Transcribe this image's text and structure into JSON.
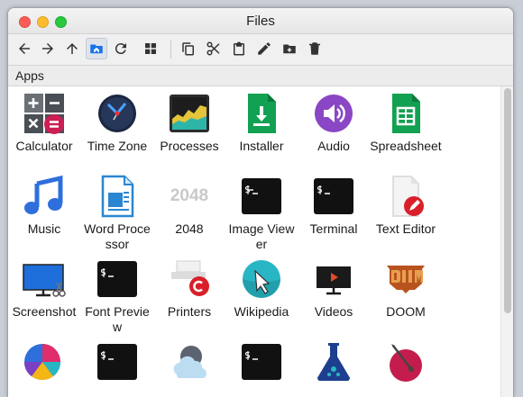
{
  "window": {
    "title": "Files"
  },
  "section": {
    "label": "Apps"
  },
  "icons": {
    "2048": "2048"
  },
  "apps": {
    "calculator": "Calculator",
    "time_zone": "Time Zone",
    "processes": "Processes",
    "installer": "Installer",
    "audio": "Audio",
    "spreadsheet": "Spreadsheet",
    "music": "Music",
    "word_processor": "Word Processor",
    "game_2048": "2048",
    "image_viewer": "Image Viewer",
    "terminal": "Terminal",
    "text_editor": "Text Editor",
    "screenshot": "Screenshot",
    "font_preview": "Font Preview",
    "printers": "Printers",
    "wikipedia": "Wikipedia",
    "videos": "Videos",
    "doom": "DOOM"
  },
  "colors": {
    "accent": "#1a73e8",
    "terminal_bg": "#111111",
    "installer_green": "#12a152",
    "audio_purple": "#8a46c4",
    "music_blue": "#2e6fdc",
    "doom_orange": "#b8521e",
    "printer_red": "#d9202a"
  }
}
